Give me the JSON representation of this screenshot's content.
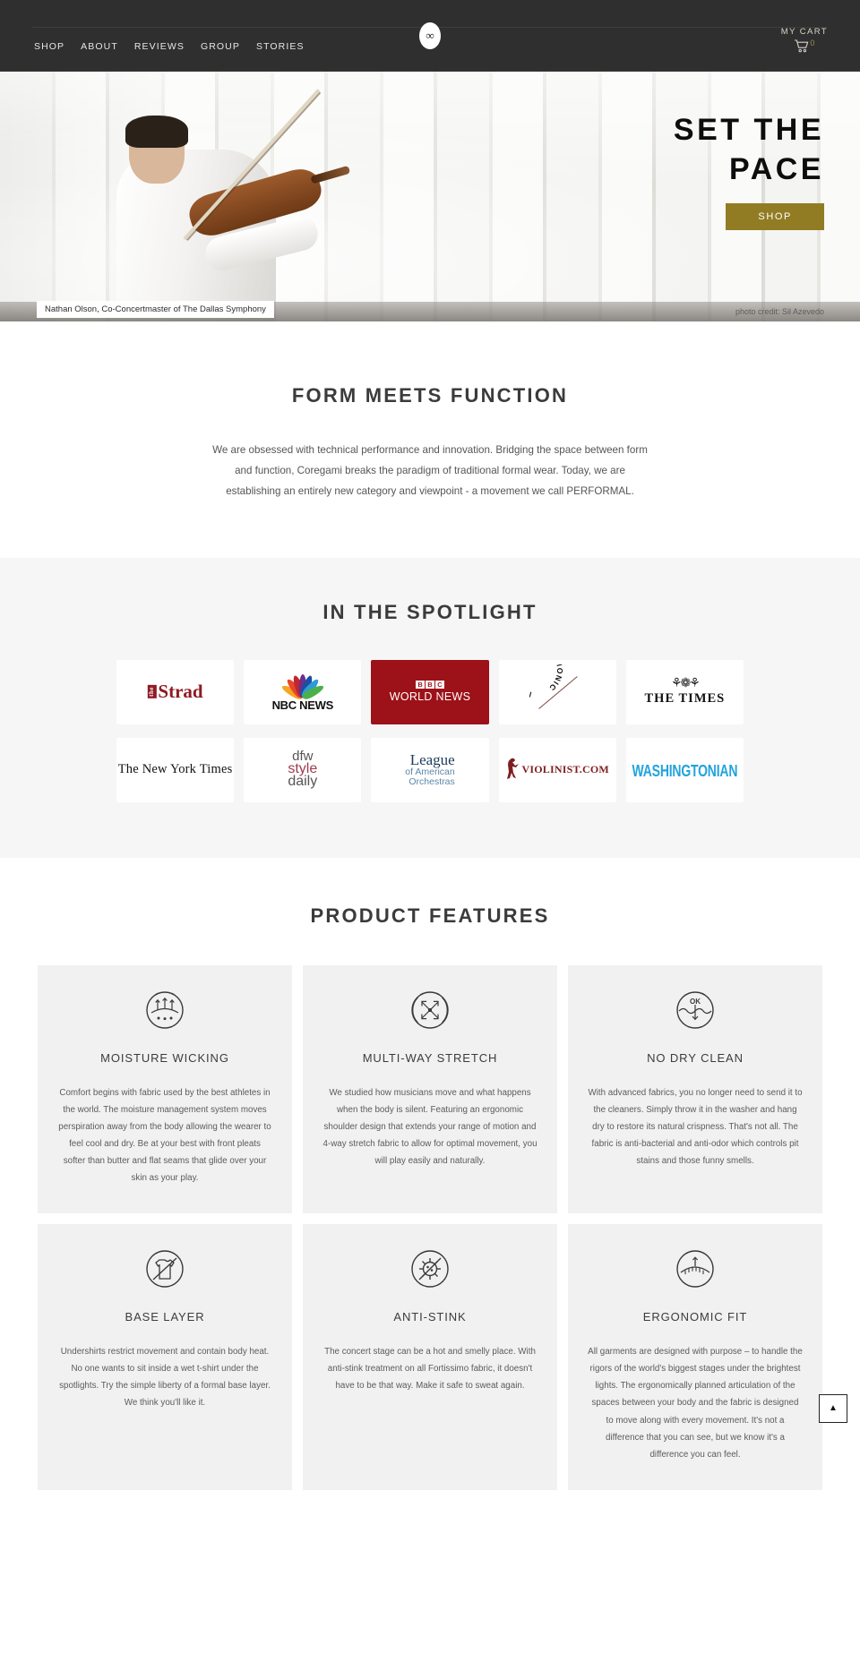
{
  "header": {
    "nav": [
      {
        "label": "SHOP"
      },
      {
        "label": "ABOUT"
      },
      {
        "label": "REVIEWS"
      },
      {
        "label": "GROUP"
      },
      {
        "label": "STORIES"
      }
    ],
    "logo_glyph": "∞",
    "cart_label": "MY CART",
    "cart_count": "0"
  },
  "hero": {
    "title_line1": "SET THE",
    "title_line2": "PACE",
    "button": "SHOP",
    "caption": "Nathan Olson, Co-Concertmaster of The Dallas Symphony",
    "credit": "photo credit: Sil Azevedo",
    "accent_color": "#917c23"
  },
  "intro": {
    "title": "FORM MEETS FUNCTION",
    "body": "We are obsessed with technical performance and innovation. Bridging the space between form and function, Coregami breaks the paradigm of traditional formal wear. Today, we are establishing an entirely new category and viewpoint - a movement we call PERFORMAL."
  },
  "spotlight": {
    "title": "IN THE SPOTLIGHT",
    "logos": [
      {
        "name": "the-strad",
        "text": "Strad",
        "sub": "the",
        "color": "#8f1a25"
      },
      {
        "name": "nbc-news",
        "text": "NBC NEWS",
        "color": "#111111"
      },
      {
        "name": "bbc-world-news",
        "text": "WORLD NEWS",
        "sub": "BBC",
        "color": "#9d1118"
      },
      {
        "name": "new-york-philharmonic",
        "text": "NEW YORK PHILHARMONIC",
        "color": "#1a1a1a"
      },
      {
        "name": "the-times",
        "text": "THE TIMES",
        "color": "#111111"
      },
      {
        "name": "the-new-york-times",
        "text": "The New York Times",
        "color": "#111111"
      },
      {
        "name": "dfw-style-daily",
        "text": "dfw style daily",
        "color": "#9e3b4e"
      },
      {
        "name": "league-of-american-orchestras",
        "text": "League of American Orchestras",
        "color": "#1b3a5c"
      },
      {
        "name": "violinist-com",
        "text": "VIOLINIST.COM",
        "color": "#7e1f1f"
      },
      {
        "name": "washingtonian",
        "text": "WASHINGTONIAN",
        "color": "#22a3dd"
      }
    ]
  },
  "features": {
    "title": "PRODUCT FEATURES",
    "items": [
      {
        "icon": "moisture-wicking-icon",
        "title": "MOISTURE WICKING",
        "text": "Comfort begins with fabric used by the best athletes in the world. The moisture management system moves perspiration away from the body allowing the wearer to feel cool and dry. Be at your best with front pleats softer than butter and flat seams that glide over your skin as your play."
      },
      {
        "icon": "multi-way-stretch-icon",
        "title": "MULTI-WAY STRETCH",
        "text": "We studied how musicians move and what happens when the body is silent. Featuring an ergonomic shoulder design that extends your range of motion and 4-way stretch fabric to allow for optimal movement, you will play easily and naturally."
      },
      {
        "icon": "no-dry-clean-icon",
        "title": "NO DRY CLEAN",
        "text": "With advanced fabrics, you no longer need to send it to the cleaners. Simply throw it in the washer and hang dry to restore its natural crispness. That's not all. The fabric is anti-bacterial and anti-odor which controls pit stains and those funny smells."
      },
      {
        "icon": "base-layer-icon",
        "title": "BASE LAYER",
        "text": "Undershirts restrict movement and contain body heat. No one wants to sit inside a wet t-shirt under the spotlights. Try the simple liberty of a formal base layer. We think you'll like it."
      },
      {
        "icon": "anti-stink-icon",
        "title": "ANTI-STINK",
        "text": "The concert stage can be a hot and smelly place. With anti-stink treatment on all Fortissimo fabric, it doesn't have to be that way. Make it safe to sweat again."
      },
      {
        "icon": "ergonomic-fit-icon",
        "title": "ERGONOMIC FIT",
        "text": "All garments are designed with purpose – to handle the rigors of the world's biggest stages under the brightest lights. The ergonomically planned articulation of the spaces between your body and the fabric is designed to move along with every movement. It's not a difference that you can see, but we know it's a difference you can feel."
      }
    ]
  },
  "scroll_top": {
    "glyph": "▲"
  }
}
